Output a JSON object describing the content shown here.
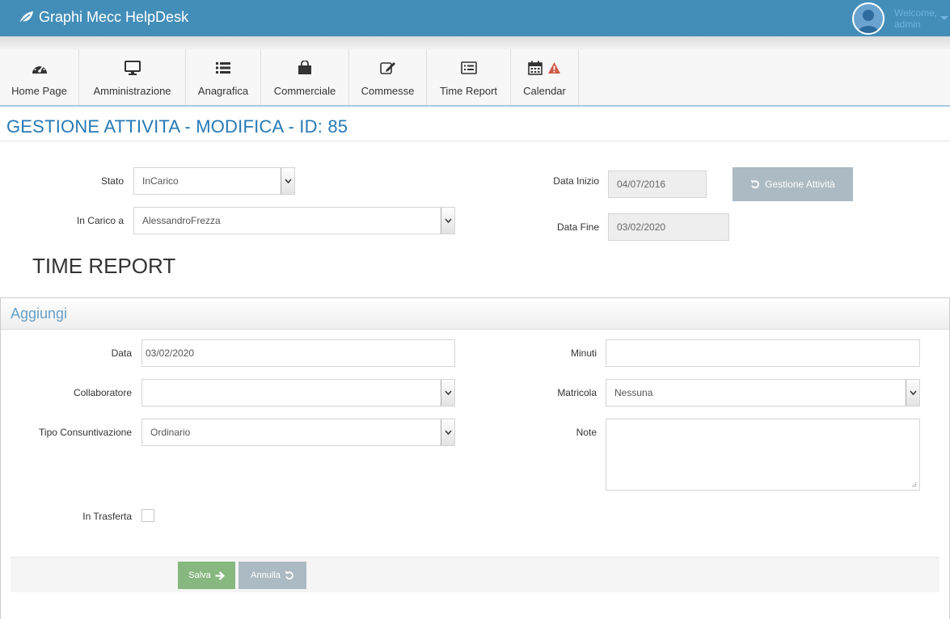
{
  "app": {
    "title": "Graphi Mecc HelpDesk"
  },
  "user": {
    "welcome": "Welcome,",
    "name": "admin"
  },
  "nav": [
    {
      "label": "Home Page",
      "icon": "dashboard-icon"
    },
    {
      "label": "Amministrazione",
      "icon": "desktop-icon"
    },
    {
      "label": "Anagrafica",
      "icon": "list-icon"
    },
    {
      "label": "Commerciale",
      "icon": "shopping-bag-icon"
    },
    {
      "label": "Commesse",
      "icon": "edit-icon"
    },
    {
      "label": "Time Report",
      "icon": "list-alt-icon"
    },
    {
      "label": "Calendar",
      "icon": "calendar-icon",
      "alert_icon": "warning-icon"
    }
  ],
  "page": {
    "title": "GESTIONE ATTIVITA - MODIFICA - ID: 85"
  },
  "activity": {
    "stato_label": "Stato",
    "stato_value": "InCarico",
    "incarico_label": "In Carico a",
    "incarico_value": "AlessandroFrezza",
    "data_inizio_label": "Data Inizio",
    "data_inizio_value": "04/07/2016",
    "data_fine_label": "Data Fine",
    "data_fine_value": "03/02/2020",
    "gestione_button": "Gestione Attività"
  },
  "section": {
    "title": "TIME REPORT"
  },
  "widget": {
    "title": "Aggiungi",
    "data_label": "Data",
    "data_value": "03/02/2020",
    "collaboratore_label": "Collaboratore",
    "collaboratore_value": "",
    "tipo_label": "Tipo Consuntivazione",
    "tipo_value": "Ordinario",
    "trasferta_label": "In Trasferta",
    "trasferta_checked": false,
    "minuti_label": "Minuti",
    "minuti_value": "",
    "matricola_label": "Matricola",
    "matricola_value": "Nessuna",
    "note_label": "Note",
    "note_value": "",
    "salva_button": "Salva",
    "annulla_button": "Annulla"
  },
  "colors": {
    "topbar": "#438eb9",
    "title_blue": "#2679b5",
    "widget_title": "#669fc7",
    "btn_success": "#87b87f",
    "btn_default": "#abbac3",
    "warning": "#d15b47"
  }
}
